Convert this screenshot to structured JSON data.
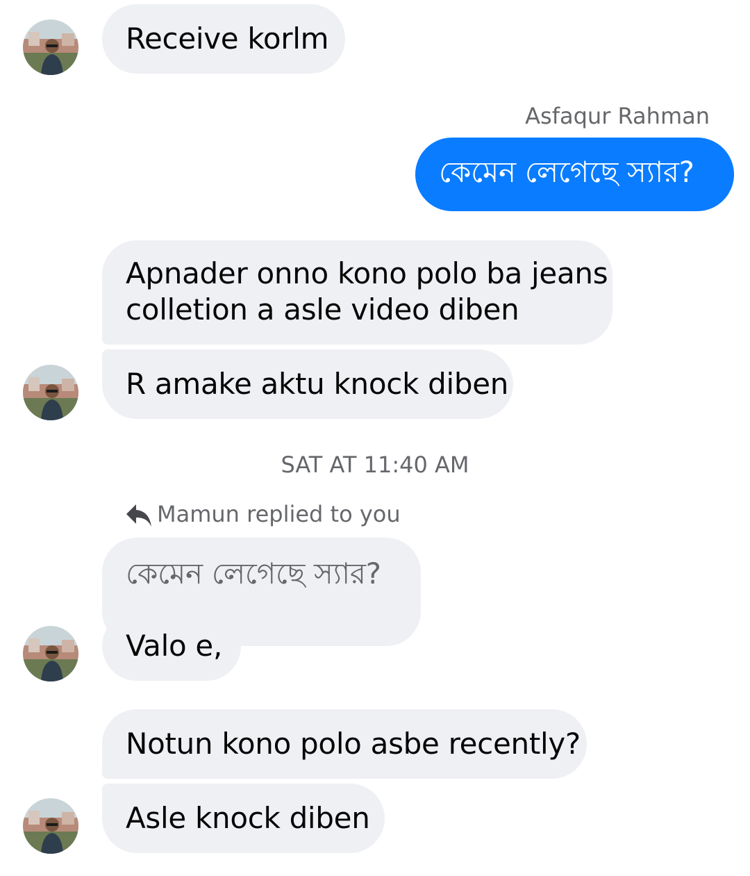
{
  "conversation": {
    "contact_name": "Mamun",
    "sender_name_label": "Asfaqur Rahman",
    "timestamp": "SAT AT 11:40 AM",
    "reply_indicator": "Mamun replied to you",
    "messages": [
      {
        "text": "Receive korlm"
      },
      {
        "text": "কেমেন লেগেছে স্যার?"
      },
      {
        "line1": "Apnader onno kono polo ba jeans",
        "line2": "colletion a asle video diben"
      },
      {
        "text": "R amake aktu knock diben"
      },
      {
        "text": "কেমেন লেগেছে স্যার?"
      },
      {
        "text": "Valo e,"
      },
      {
        "text": "Notun kono polo asbe recently?"
      },
      {
        "text": "Asle knock diben"
      }
    ]
  },
  "colors": {
    "incoming_bubble": "#eff0f4",
    "outgoing_bubble": "#0a7cff",
    "meta_text": "#65676b"
  },
  "icons": {
    "reply": "reply-arrow-icon",
    "avatar": "contact-avatar"
  }
}
